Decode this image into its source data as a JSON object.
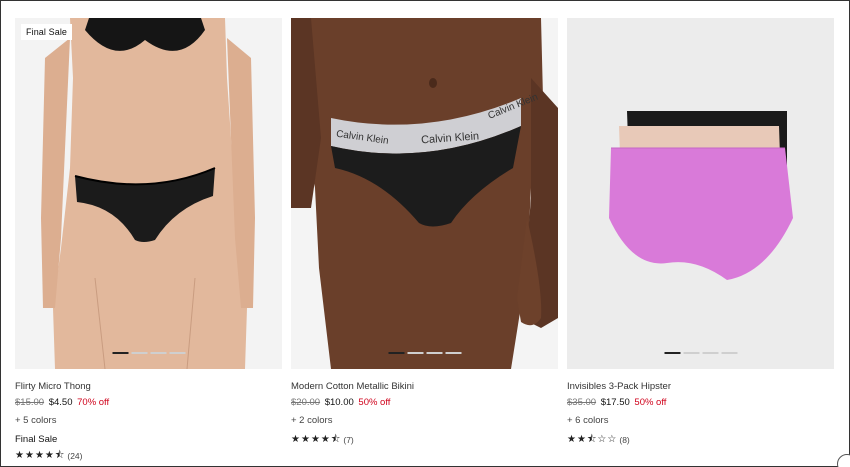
{
  "products": [
    {
      "badge": "Final Sale",
      "name": "Flirty Micro Thong",
      "original_price": "$15.00",
      "sale_price": "$4.50",
      "discount": "70% off",
      "colors": "+ 5 colors",
      "final_sale_label": "Final Sale",
      "rating": 4.5,
      "stars": [
        "star-full",
        "star-full",
        "star-full",
        "star-full",
        "star-half"
      ],
      "review_count": "(24)",
      "carousel_dots": 4,
      "carousel_active": 0
    },
    {
      "name": "Modern Cotton Metallic Bikini",
      "original_price": "$20.00",
      "sale_price": "$10.00",
      "discount": "50% off",
      "colors": "+ 2 colors",
      "rating": 4.5,
      "stars": [
        "star-full",
        "star-full",
        "star-full",
        "star-full",
        "star-half"
      ],
      "review_count": "(7)",
      "waistband_text": "Calvin Klein",
      "carousel_dots": 4,
      "carousel_active": 0
    },
    {
      "name": "Invisibles 3-Pack Hipster",
      "original_price": "$35.00",
      "sale_price": "$17.50",
      "discount": "50% off",
      "colors": "+ 6 colors",
      "rating": 2.5,
      "stars": [
        "star-full",
        "star-full",
        "star-half",
        "star-empty",
        "star-empty"
      ],
      "review_count": "(8)",
      "carousel_dots": 4,
      "carousel_active": 0
    }
  ],
  "colors": {
    "discount_red": "#d0021b",
    "text_dark": "#222222",
    "panty_pink": "#d97ad9",
    "panty_beige": "#e8c9b8",
    "panty_black": "#1a1a1a"
  }
}
